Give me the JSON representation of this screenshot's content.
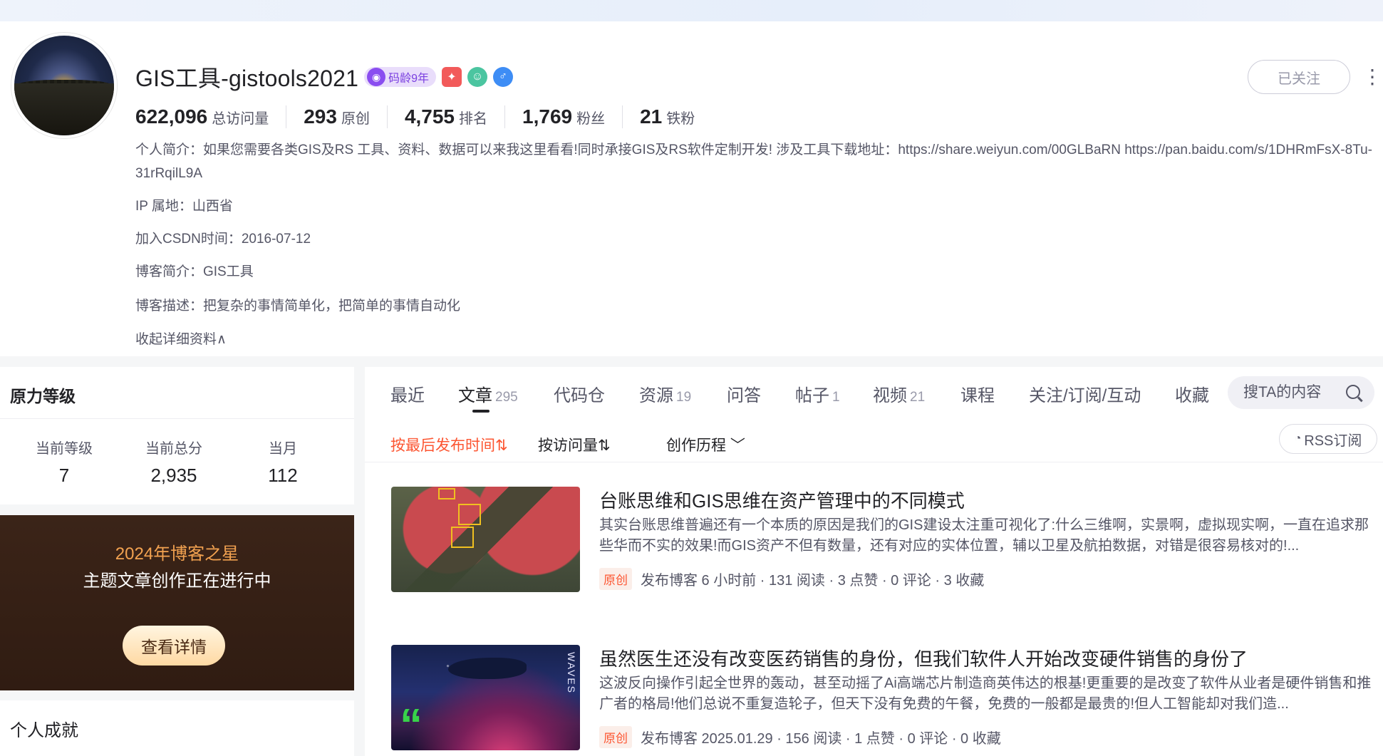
{
  "profile": {
    "name": "GIS工具-gistools2021",
    "age_badge": "码龄9年",
    "follow_label": "已关注",
    "more_label": "⋮",
    "stats": [
      {
        "num": "622,096",
        "label": "总访问量"
      },
      {
        "num": "293",
        "label": "原创"
      },
      {
        "num": "4,755",
        "label": "排名"
      },
      {
        "num": "1,769",
        "label": "粉丝"
      },
      {
        "num": "21",
        "label": "铁粉"
      }
    ],
    "intro": "个人简介：如果您需要各类GIS及RS 工具、资料、数据可以来我这里看看!同时承接GIS及RS软件定制开发! 涉及工具下载地址：https://share.weiyun.com/00GLBaRN https://pan.baidu.com/s/1DHRmFsX-8Tu-31rRqilL9A",
    "ip": "IP 属地：山西省",
    "join": "加入CSDN时间：2016-07-12",
    "blog_intro": "博客简介：GIS工具",
    "blog_desc": "博客描述：把复杂的事情简单化，把简单的事情自动化",
    "collapse": "收起详细资料∧"
  },
  "sidebar": {
    "level_title": "原力等级",
    "level_cols": [
      {
        "label": "当前等级",
        "value": "7"
      },
      {
        "label": "当前总分",
        "value": "2,935"
      },
      {
        "label": "当月",
        "value": "112"
      }
    ],
    "star_title": "2024年博客之星",
    "star_sub": "主题文章创作正在进行中",
    "star_btn": "查看详情",
    "ach_title": "个人成就"
  },
  "tabs": [
    {
      "label": "最近",
      "count": ""
    },
    {
      "label": "文章",
      "count": "295"
    },
    {
      "label": "代码仓",
      "count": ""
    },
    {
      "label": "资源",
      "count": "19"
    },
    {
      "label": "问答",
      "count": ""
    },
    {
      "label": "帖子",
      "count": "1"
    },
    {
      "label": "视频",
      "count": "21"
    },
    {
      "label": "课程",
      "count": ""
    },
    {
      "label": "关注/订阅/互动",
      "count": ""
    },
    {
      "label": "收藏",
      "count": ""
    }
  ],
  "search": {
    "placeholder": "搜TA的内容"
  },
  "sort": {
    "latest": "按最后发布时间⇅",
    "views": "按访问量⇅",
    "history": "创作历程 ﹀",
    "rss": "RSS订阅"
  },
  "articles": [
    {
      "title": "台账思维和GIS思维在资产管理中的不同模式",
      "desc": "其实台账思维普遍还有一个本质的原因是我们的GIS建设太注重可视化了:什么三维啊，实景啊，虚拟现实啊，一直在追求那些华而不实的效果!而GIS资产不但有数量，还有对应的实体位置，辅以卫星及航拍数据，对错是很容易核对的!...",
      "tag": "原创",
      "meta": "发布博客 6 小时前 · 131 阅读 · 3 点赞 · 0 评论 · 3 收藏"
    },
    {
      "title": "虽然医生还没有改变医药销售的身份，但我们软件人开始改变硬件销售的身份了",
      "desc": "这波反向操作引起全世界的轰动，甚至动摇了Ai高端芯片制造商英伟达的根基!更重要的是改变了软件从业者是硬件销售和推广者的格局!他们总说不重复造轮子，但天下没有免费的午餐，免费的一般都是最贵的!但人工智能却对我们造...",
      "tag": "原创",
      "meta": "发布博客 2025.01.29 · 156 阅读 · 1 点赞 · 0 评论 · 0 收藏",
      "thumb_text": "WAVES"
    }
  ],
  "colors": {
    "accent": "#fc5531",
    "text": "#222226",
    "muted": "#555666",
    "star_bg": "#3b2418"
  }
}
